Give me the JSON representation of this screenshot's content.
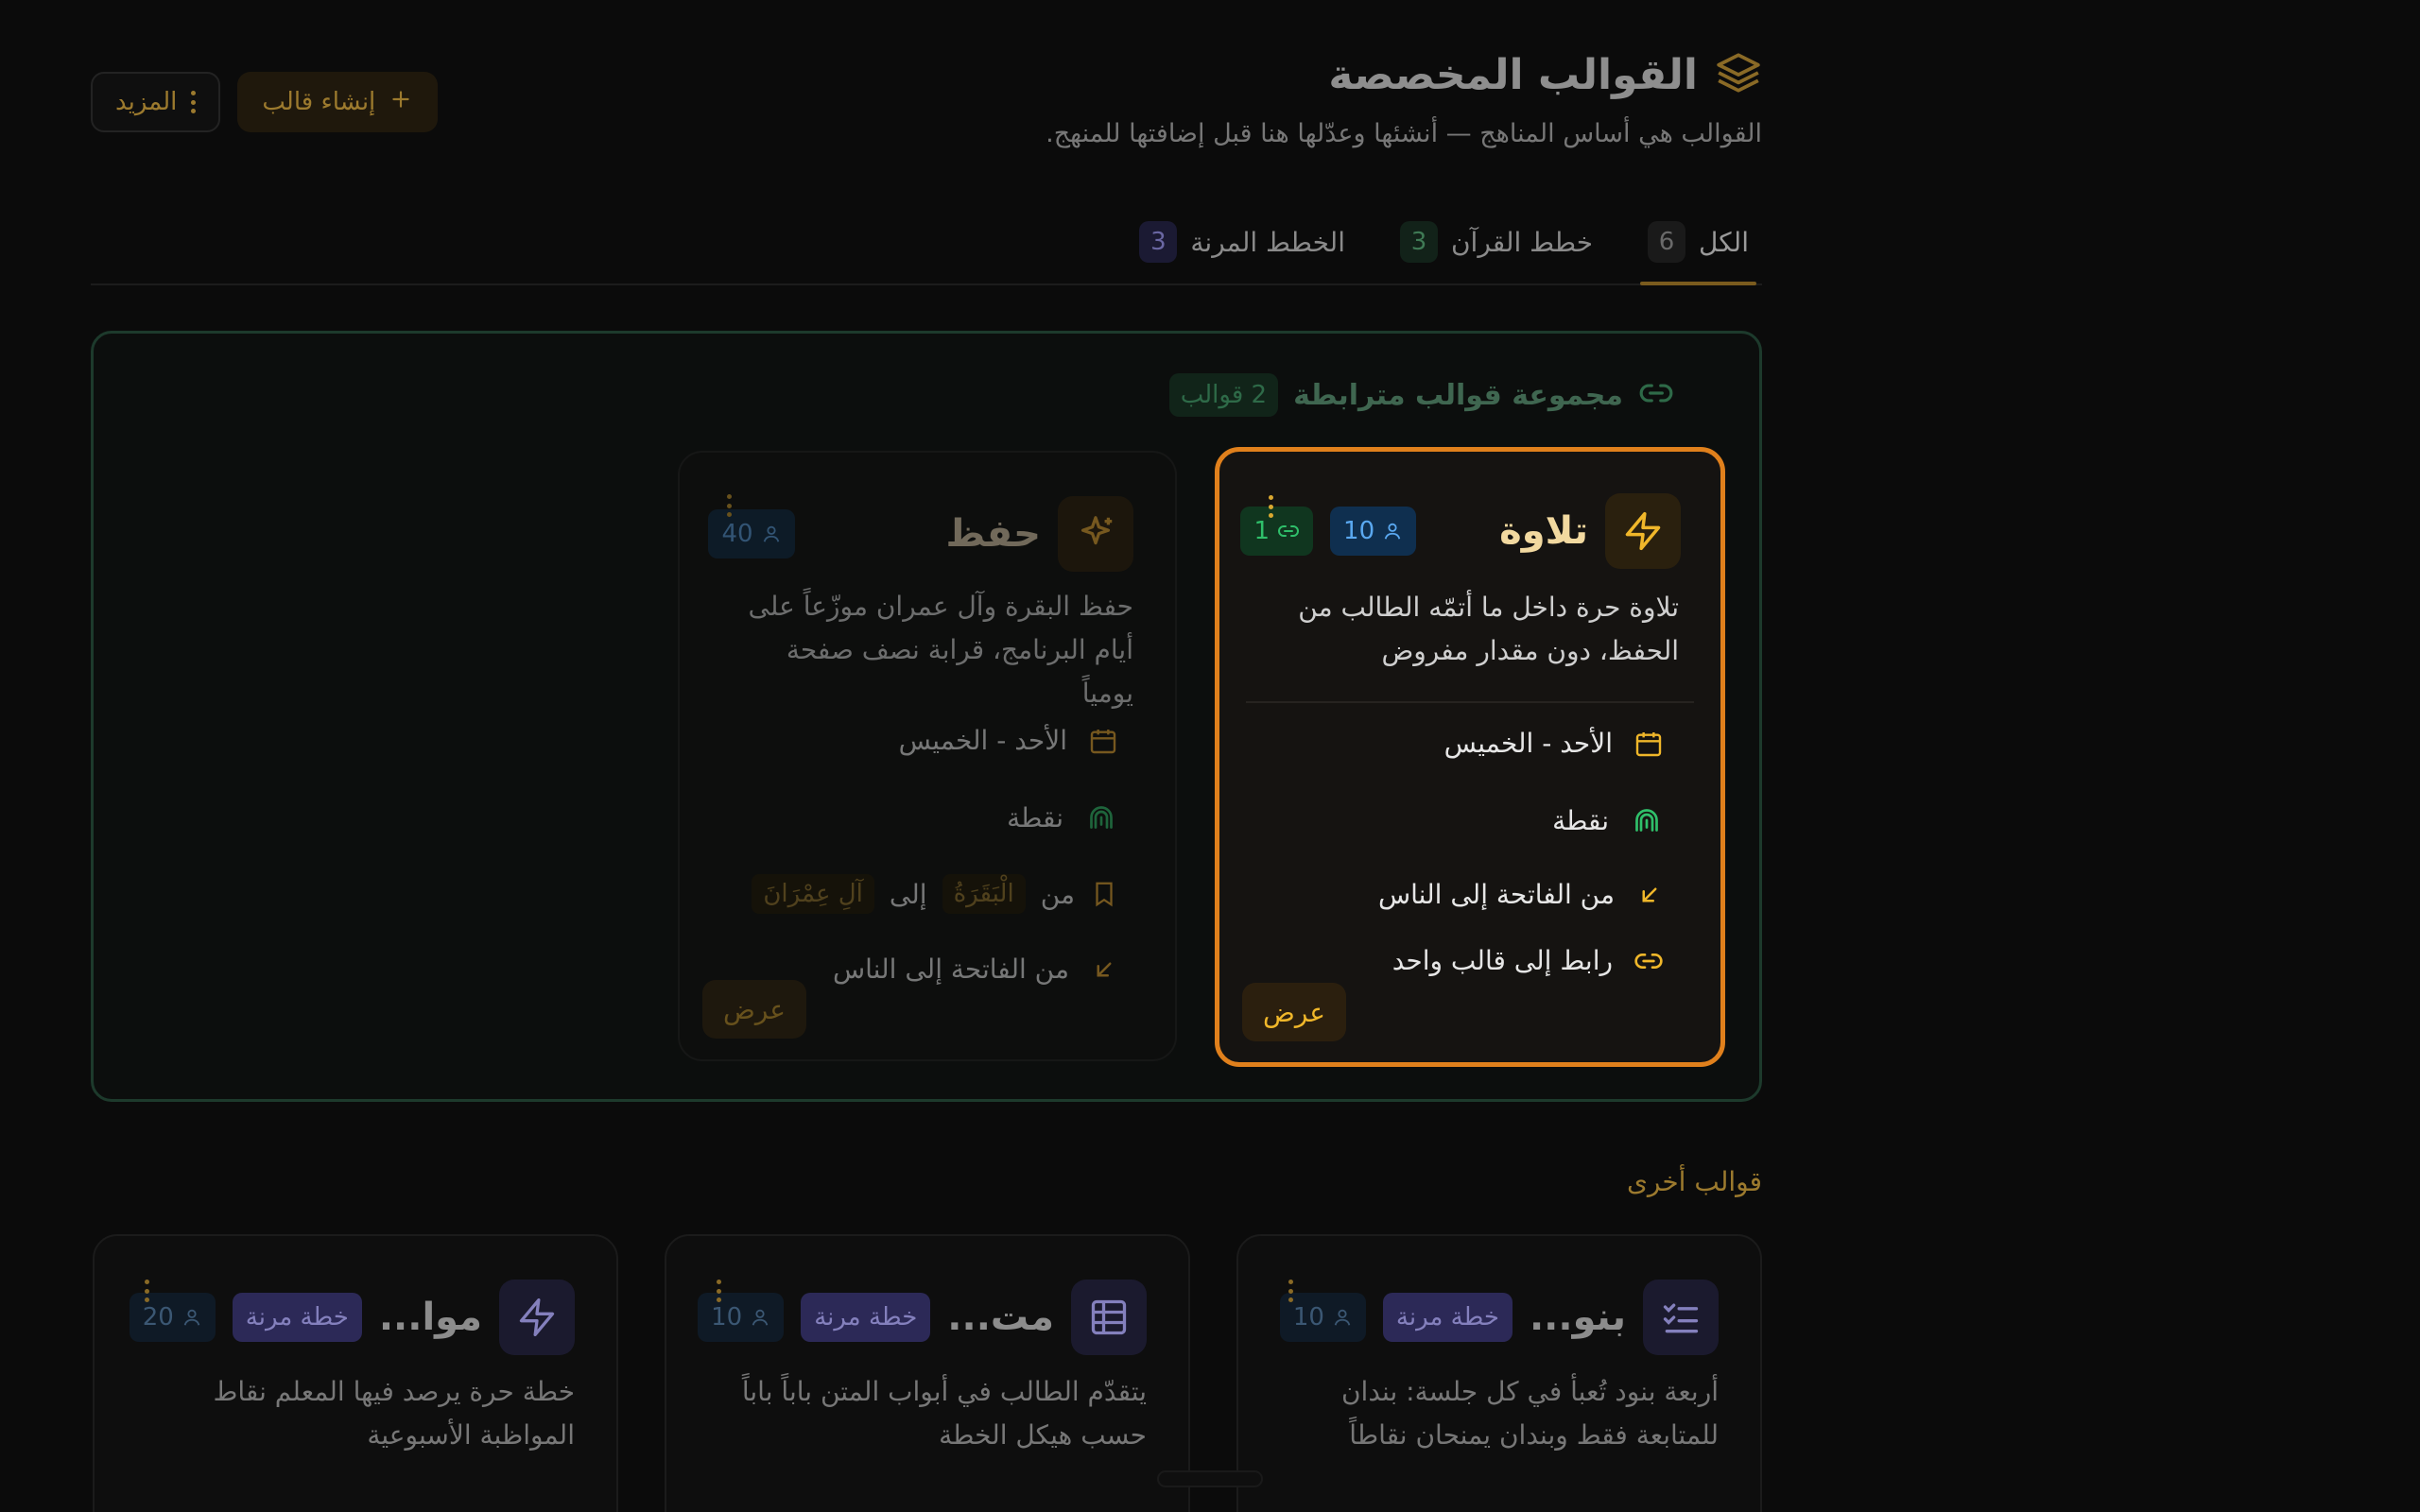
{
  "header": {
    "title": "القوالب المخصصة",
    "subtitle": "القوالب هي أساس المناهج — أنشئها وعدّلها هنا قبل إضافتها للمنهج.",
    "create_label": "إنشاء قالب",
    "more_label": "المزيد"
  },
  "tabs": [
    {
      "label": "الكل",
      "count": "6",
      "active": true
    },
    {
      "label": "خطط القرآن",
      "count": "3"
    },
    {
      "label": "الخطط المرنة",
      "count": "3"
    }
  ],
  "group": {
    "title": "مجموعة قوالب مترابطة",
    "badge": "2 قوالب",
    "cards": [
      {
        "title": "تلاوة",
        "users": "10",
        "links": "1",
        "description": "تلاوة حرة داخل ما أتمّه الطالب من الحفظ، دون مقدار مفروض",
        "days": "الأحد - الخميس",
        "scoring": "نقطة",
        "range": "من الفاتحة إلى الناس",
        "link_text": "رابط إلى قالب واحد",
        "view_label": "عرض"
      },
      {
        "title": "حفظ",
        "users": "40",
        "description": "حفظ البقرة وآل عمران موزّعاً على أيام البرنامج، قرابة نصف صفحة يومياً",
        "days": "الأحد - الخميس",
        "scoring": "نقطة",
        "from_word": "من",
        "from_surah": "الْبَقَرَةُ",
        "to_word": "إلى",
        "to_surah": "آلِ عِمْرَانَ",
        "range": "من الفاتحة إلى الناس",
        "view_label": "عرض"
      }
    ]
  },
  "others": {
    "label": "قوالب أخرى",
    "cards": [
      {
        "title": "بنو...",
        "tag": "خطة مرنة",
        "users": "10",
        "description": "أربعة بنود تُعبأ في كل جلسة: بندان للمتابعة فقط وبندان يمنحان نقاطاً"
      },
      {
        "title": "مت...",
        "tag": "خطة مرنة",
        "users": "10",
        "description": "يتقدّم الطالب في أبواب المتن باباً باباً حسب هيكل الخطة"
      },
      {
        "title": "موا...",
        "tag": "خطة مرنة",
        "users": "20",
        "description": "خطة حرة يرصد فيها المعلم نقاط المواظبة الأسبوعية"
      }
    ]
  },
  "colors": {
    "accent": "#e0801c",
    "gold": "#f0b72a",
    "green": "#2fbf6a",
    "blue": "#5aa8f0",
    "purple": "#8480bd"
  }
}
